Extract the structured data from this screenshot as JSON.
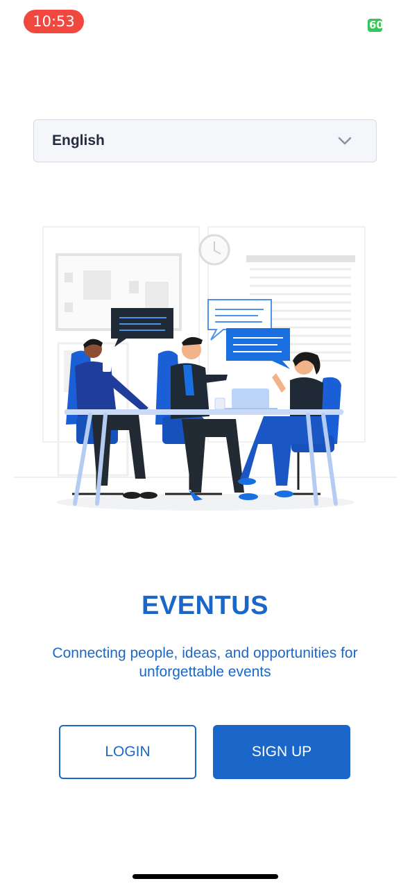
{
  "status_bar": {
    "time": "10:53",
    "battery": "60"
  },
  "language_selector": {
    "value": "English"
  },
  "hero": {
    "illustration": "team-meeting-illustration"
  },
  "app": {
    "title": "EVENTUS",
    "tagline": "Connecting people, ideas, and opportunities for unforgettable events"
  },
  "actions": {
    "login_label": "LOGIN",
    "signup_label": "SIGN UP"
  },
  "colors": {
    "primary": "#1a67c9",
    "time_pill": "#f0483e",
    "battery": "#35c759"
  },
  "icons": {
    "dropdown": "chevron-down-icon"
  }
}
